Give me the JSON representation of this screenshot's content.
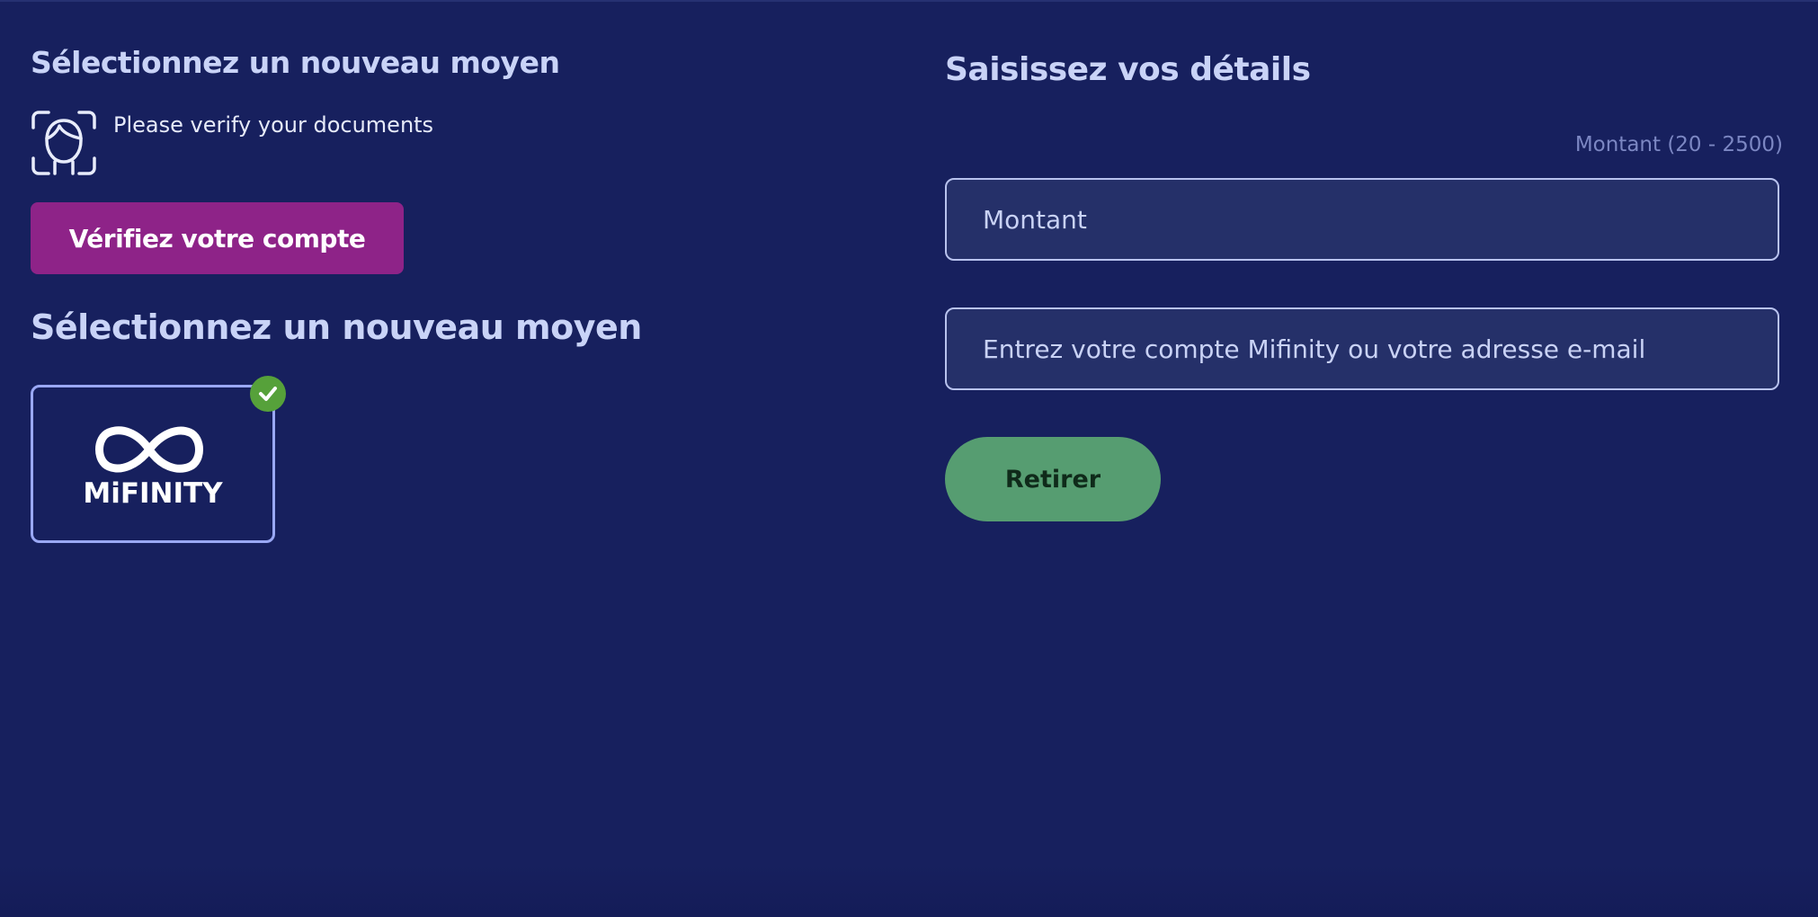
{
  "left": {
    "title_top": "Sélectionnez un nouveau moyen",
    "verify_message": "Please verify your documents",
    "verify_button": "Vérifiez votre compte",
    "title_methods": "Sélectionnez un nouveau moyen",
    "methods": [
      {
        "name": "MiFINITY",
        "selected": true
      }
    ]
  },
  "right": {
    "title": "Saisissez vos détails",
    "amount_hint": "Montant (20 - 2500)",
    "amount_placeholder": "Montant",
    "account_placeholder": "Entrez votre compte Mifinity ou votre adresse e-mail",
    "withdraw_button": "Retirer"
  },
  "colors": {
    "background": "#17205e",
    "verify_button": "#8e2388",
    "withdraw_button": "#569d71",
    "selected_check": "#56a13a",
    "card_border": "#9aa8f5"
  },
  "icons": [
    "face-scan-icon",
    "mifinity-logo",
    "check-icon"
  ]
}
